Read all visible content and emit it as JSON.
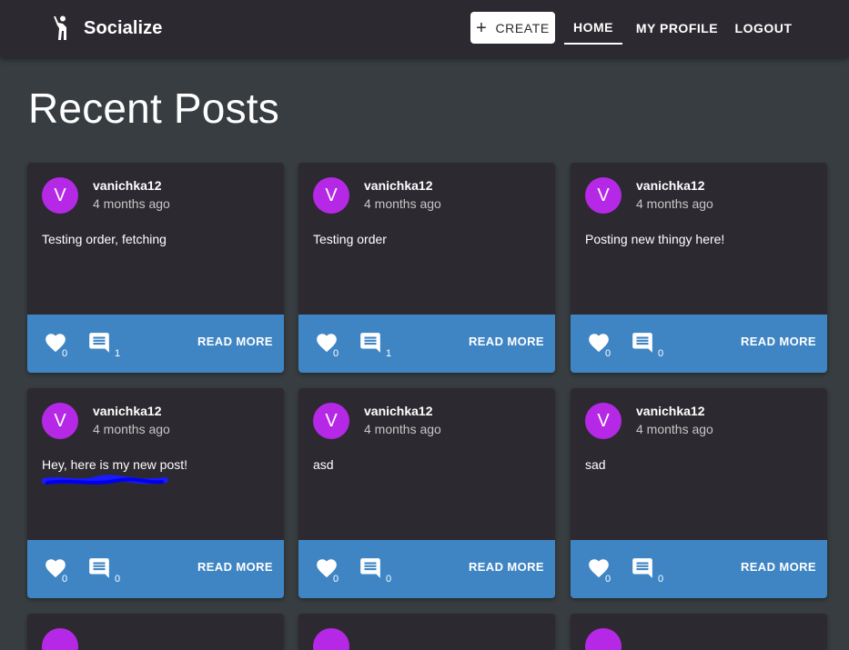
{
  "app": {
    "name": "Socialize",
    "logo_icon": "person-waving-icon"
  },
  "nav": {
    "create_label": "CREATE",
    "home_label": "HOME",
    "profile_label": "MY PROFILE",
    "logout_label": "LOGOUT"
  },
  "page": {
    "title": "Recent Posts"
  },
  "colors": {
    "appbar": "#2d2930",
    "background": "#373d40",
    "card": "#2d2930",
    "actions": "#3f85c4",
    "avatar": "#b529e6"
  },
  "posts": [
    {
      "avatar": "V",
      "username": "vanichka12",
      "time": "4 months ago",
      "content": "Testing order, fetching",
      "likes": "0",
      "comments": "1",
      "read_more": "READ MORE"
    },
    {
      "avatar": "V",
      "username": "vanichka12",
      "time": "4 months ago",
      "content": "Testing order",
      "likes": "0",
      "comments": "1",
      "read_more": "READ MORE"
    },
    {
      "avatar": "V",
      "username": "vanichka12",
      "time": "4 months ago",
      "content": "Posting new thingy here!",
      "likes": "0",
      "comments": "0",
      "read_more": "READ MORE"
    },
    {
      "avatar": "V",
      "username": "vanichka12",
      "time": "4 months ago",
      "content": "Hey, here is my new post!",
      "likes": "0",
      "comments": "0",
      "read_more": "READ MORE"
    },
    {
      "avatar": "V",
      "username": "vanichka12",
      "time": "4 months ago",
      "content": "asd",
      "likes": "0",
      "comments": "0",
      "read_more": "READ MORE"
    },
    {
      "avatar": "V",
      "username": "vanichka12",
      "time": "4 months ago",
      "content": "sad",
      "likes": "0",
      "comments": "0",
      "read_more": "READ MORE"
    }
  ]
}
